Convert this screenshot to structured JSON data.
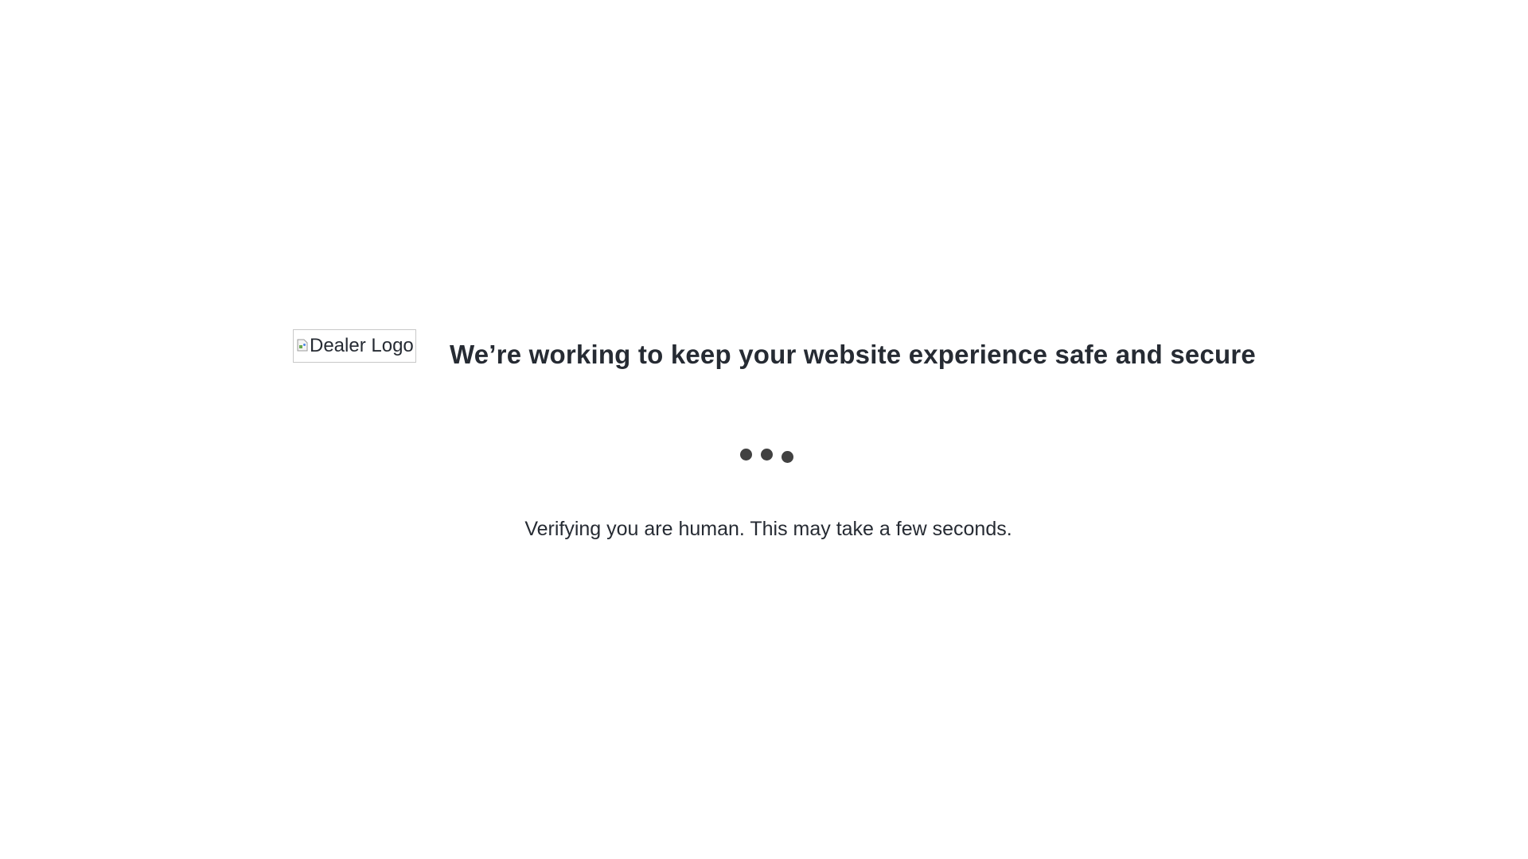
{
  "logo": {
    "alt_text": "Dealer Logo",
    "icon": "broken-image-icon"
  },
  "headline": "We’re working to keep your website experience safe and secure",
  "loader": {
    "icon": "loading-dots-icon",
    "dot_color": "#414141"
  },
  "status_message": "Verifying you are human. This may take a few seconds."
}
